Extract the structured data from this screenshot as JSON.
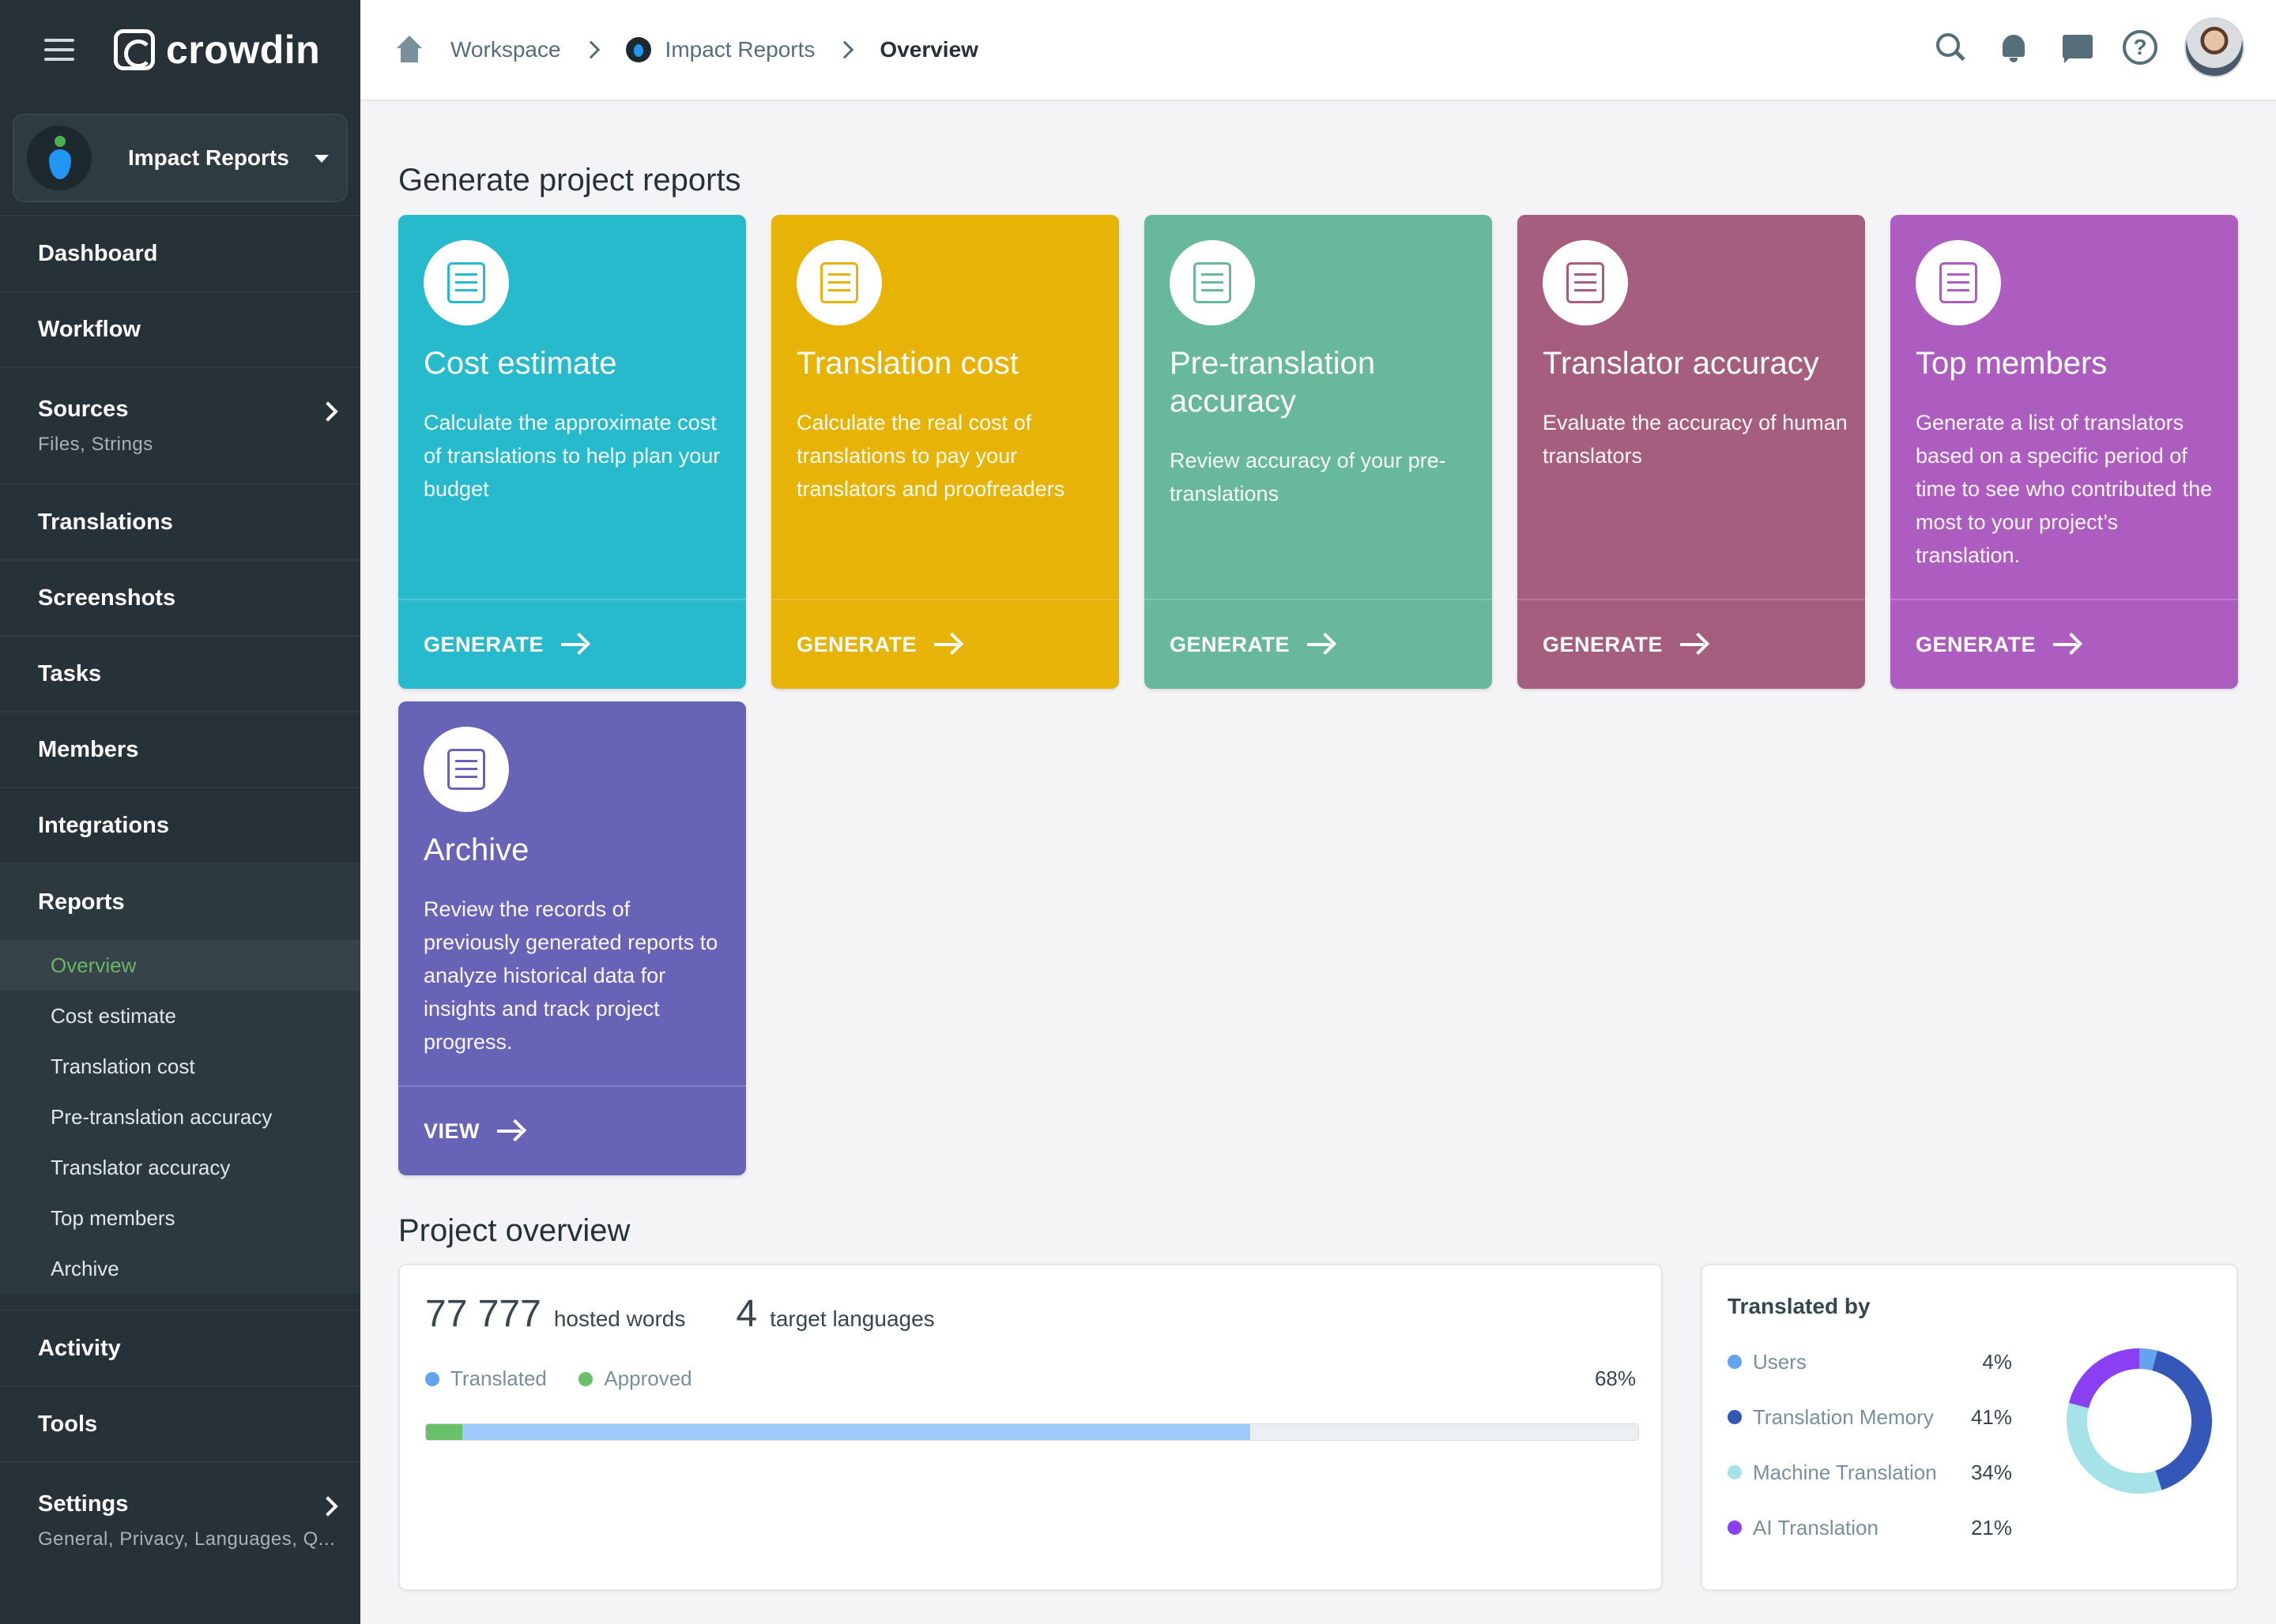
{
  "app": {
    "name": "crowdin",
    "project": "Impact Reports"
  },
  "breadcrumb": {
    "workspace": "Workspace",
    "project": "Impact Reports",
    "current": "Overview"
  },
  "nav": {
    "dashboard": "Dashboard",
    "workflow": "Workflow",
    "sources": "Sources",
    "sources_sub": "Files, Strings",
    "translations": "Translations",
    "screenshots": "Screenshots",
    "tasks": "Tasks",
    "members": "Members",
    "integrations": "Integrations",
    "reports": "Reports",
    "reports_items": [
      "Overview",
      "Cost estimate",
      "Translation cost",
      "Pre-translation accuracy",
      "Translator accuracy",
      "Top members",
      "Archive"
    ],
    "activity": "Activity",
    "tools": "Tools",
    "settings": "Settings",
    "settings_sub": "General, Privacy, Languages, Q..."
  },
  "main": {
    "reports_title": "Generate project reports",
    "overview_title": "Project overview",
    "cards": [
      {
        "title": "Cost estimate",
        "desc": "Calculate the approximate cost of translations to help plan your budget",
        "action": "GENERATE",
        "color": "#27b9cc"
      },
      {
        "title": "Translation cost",
        "desc": "Calculate the real cost of translations to pay your translators and proofreaders",
        "action": "GENERATE",
        "color": "#e8b307"
      },
      {
        "title": "Pre-translation accuracy",
        "desc": "Review accuracy of your pre-translations",
        "action": "GENERATE",
        "color": "#68b89c"
      },
      {
        "title": "Translator accuracy",
        "desc": "Evaluate the accuracy of human translators",
        "action": "GENERATE",
        "color": "#a55e7d"
      },
      {
        "title": "Top members",
        "desc": "Generate a list of translators based on a specific period of time to see who contributed the most to your project’s translation.",
        "action": "GENERATE",
        "color": "#ad5dbf"
      },
      {
        "title": "Archive",
        "desc": "Review the records of previously generated reports to analyze historical data for insights and track project progress.",
        "action": "VIEW",
        "color": "#6764b8"
      }
    ]
  },
  "overview": {
    "hosted_words": "77 777",
    "hosted_words_label": "hosted words",
    "target_languages": "4",
    "target_languages_label": "target languages",
    "legend_translated": "Translated",
    "legend_approved": "Approved",
    "progress_label": "68%",
    "translated_fraction": 0.65,
    "approved_fraction": 0.03
  },
  "translated_by": {
    "title": "Translated by",
    "rows": [
      {
        "label": "Users",
        "pct": "4%",
        "value": 4,
        "color": "#64a3ee"
      },
      {
        "label": "Translation Memory",
        "pct": "41%",
        "value": 41,
        "color": "#3558b8"
      },
      {
        "label": "Machine Translation",
        "pct": "34%",
        "value": 34,
        "color": "#a6e3e9"
      },
      {
        "label": "AI Translation",
        "pct": "21%",
        "value": 21,
        "color": "#8a3ff0"
      }
    ]
  },
  "colors": {
    "sidebar": "#263238",
    "active_sub": "#6ab56a",
    "translated_bar": "#9ec9fb",
    "approved_bar": "#6abf69"
  }
}
